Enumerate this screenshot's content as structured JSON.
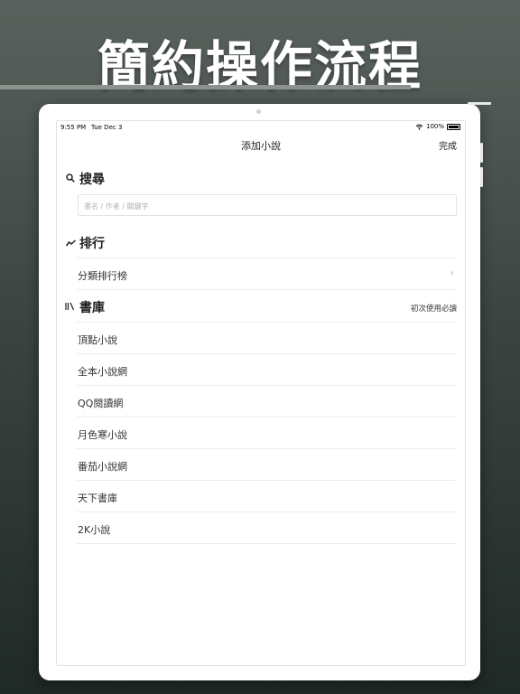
{
  "promo": {
    "headline": "簡約操作流程"
  },
  "status_bar": {
    "time": "9:55 PM",
    "date": "Tue Dec 3",
    "battery": "100%"
  },
  "nav": {
    "title": "添加小說",
    "done": "完成"
  },
  "search": {
    "title": "搜尋",
    "icon": "search-icon",
    "placeholder": "書名 / 作者 / 關鍵字",
    "value": ""
  },
  "ranking": {
    "title": "排行",
    "icon": "trend-icon",
    "items": [
      {
        "label": "分類排行榜"
      }
    ]
  },
  "library": {
    "title": "書庫",
    "icon": "library-icon",
    "link": "初次使用必讀",
    "items": [
      {
        "label": "頂點小說"
      },
      {
        "label": "全本小說網"
      },
      {
        "label": "QQ閱讀網"
      },
      {
        "label": "月色寒小說"
      },
      {
        "label": "番茄小說網"
      },
      {
        "label": "天下書庫"
      },
      {
        "label": "2K小說"
      }
    ]
  }
}
